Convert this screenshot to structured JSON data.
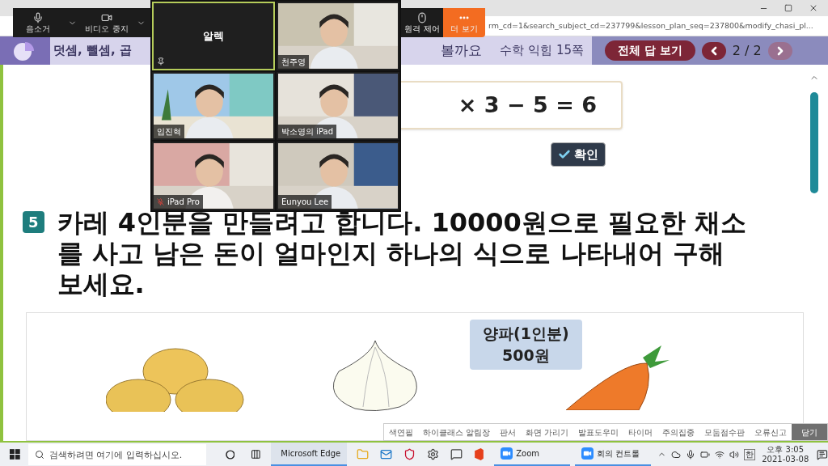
{
  "browser": {
    "url": "rm_cd=1&search_subject_cd=237799&lesson_plan_seq=237800&modify_chasi_pl..."
  },
  "zoom_toolbar": {
    "left": [
      {
        "label": "음소거",
        "kind": "mic"
      },
      {
        "label": "비디오 중지",
        "kind": "video"
      }
    ],
    "right": [
      {
        "label": "원격 제어",
        "kind": "mouse",
        "active": false
      },
      {
        "label": "더 보기",
        "kind": "more",
        "active": true
      }
    ]
  },
  "video_grid": [
    {
      "name": "알렉",
      "kind": "blank",
      "speaking": true,
      "muted": false
    },
    {
      "name": "천주영",
      "kind": "video",
      "speaking": false,
      "muted": false
    },
    {
      "name": "임진혁",
      "kind": "video",
      "speaking": false,
      "muted": false
    },
    {
      "name": "박소영의 iPad",
      "kind": "video",
      "speaking": false,
      "muted": false
    },
    {
      "name": "iPad Pro",
      "kind": "video",
      "speaking": false,
      "muted": true
    },
    {
      "name": "Eunyou Lee",
      "kind": "video",
      "speaking": false,
      "muted": false
    }
  ],
  "lesson_header": {
    "title_start": "덧셈, 뺄셈, 곱",
    "title_end": "볼까요",
    "reference": "수학 익힘 15쪽",
    "show_answers": "전체 답 보기",
    "page": "2 / 2",
    "prev_disabled": false,
    "next_disabled": true
  },
  "equation": "× 3 − 5 = 6",
  "confirm_button": "확인",
  "problem": {
    "number": "5",
    "text": "카레 4인분을 만들려고 합니다. 10000원으로 필요한 채소를 사고 남은 돈이 얼마인지 하나의 식으로 나타내어 구해 보세요."
  },
  "price_label": [
    "양파(1인분)",
    "500원"
  ],
  "tools": [
    {
      "label": "색연필",
      "kind": "tool"
    },
    {
      "label": "하이클래스 알림장",
      "kind": "tool"
    },
    {
      "label": "판서",
      "kind": "tool"
    },
    {
      "label": "화면 가리기",
      "kind": "tool"
    },
    {
      "label": "발표도우미",
      "kind": "tool"
    },
    {
      "label": "타이머",
      "kind": "tool"
    },
    {
      "label": "주의집중",
      "kind": "tool"
    },
    {
      "label": "모둠점수판",
      "kind": "tool"
    },
    {
      "label": "오류신고",
      "kind": "tool"
    },
    {
      "label": "닫기",
      "kind": "close"
    }
  ],
  "taskbar": {
    "search_placeholder": "검색하려면 여기에 입력하십시오.",
    "apps": [
      {
        "label": "Microsoft Edge",
        "kind": "edge",
        "selected": true
      },
      {
        "label": "Zoom",
        "kind": "zoom",
        "selected": false
      },
      {
        "label": "회의 컨트롤",
        "kind": "zoom",
        "selected": false
      }
    ],
    "ime": "한",
    "time": "오후 3:05",
    "date": "2021-03-08"
  }
}
